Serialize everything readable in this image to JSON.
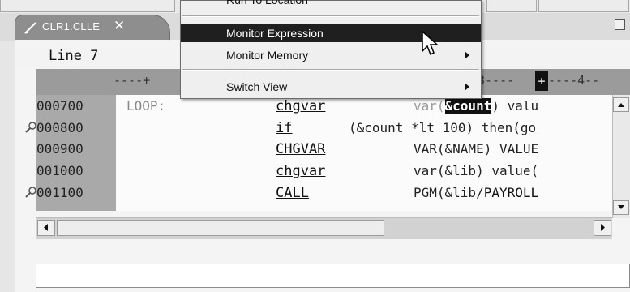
{
  "menu": {
    "items": [
      {
        "label": "Run To Location",
        "submenu": false,
        "selected": false,
        "partial": true
      },
      {
        "label": "Monitor Expression",
        "submenu": false,
        "selected": true
      },
      {
        "label": "Monitor Memory",
        "submenu": true,
        "selected": false
      },
      {
        "label": "Switch View",
        "submenu": true,
        "selected": false
      }
    ]
  },
  "editor": {
    "tab": {
      "label": "CLR1.CLLE",
      "close_glyph": "✕"
    },
    "line_indicator": "Line 7",
    "ruler": {
      "left": "----+",
      "right": "3----",
      "cursor_char": "+",
      "tail": "----4--"
    },
    "rows": [
      {
        "seq": "000700",
        "label": "LOOP:",
        "cmd": "chgvar",
        "pre": "var(",
        "hl": "&count",
        "post": ") valu",
        "breakpoint": false
      },
      {
        "seq": "000800",
        "label": "",
        "cmd": "if",
        "pre": "(&count *lt 100) then(go",
        "hl": "",
        "post": "",
        "breakpoint": true
      },
      {
        "seq": "000900",
        "label": "",
        "cmd": "CHGVAR",
        "pre": "VAR(&NAME) VALUE",
        "hl": "",
        "post": "",
        "breakpoint": false
      },
      {
        "seq": "001000",
        "label": "",
        "cmd": "chgvar",
        "pre": "var(&lib) value(",
        "hl": "",
        "post": "",
        "breakpoint": false
      },
      {
        "seq": "001100",
        "label": "",
        "cmd": "CALL",
        "pre": "PGM(&lib/",
        "strong": "PAYROLL",
        "hl": "",
        "post": "",
        "breakpoint": true
      }
    ],
    "command_line_value": ""
  },
  "icons": {
    "tab_icon": "pencil-icon",
    "breakpoint": "breakpoint-icon",
    "pointer": "mouse-pointer-icon"
  },
  "colors": {
    "menu_selection": "#1f1f1f",
    "tab_background": "#8e8e8e",
    "gutter": "#a9a9a9"
  }
}
